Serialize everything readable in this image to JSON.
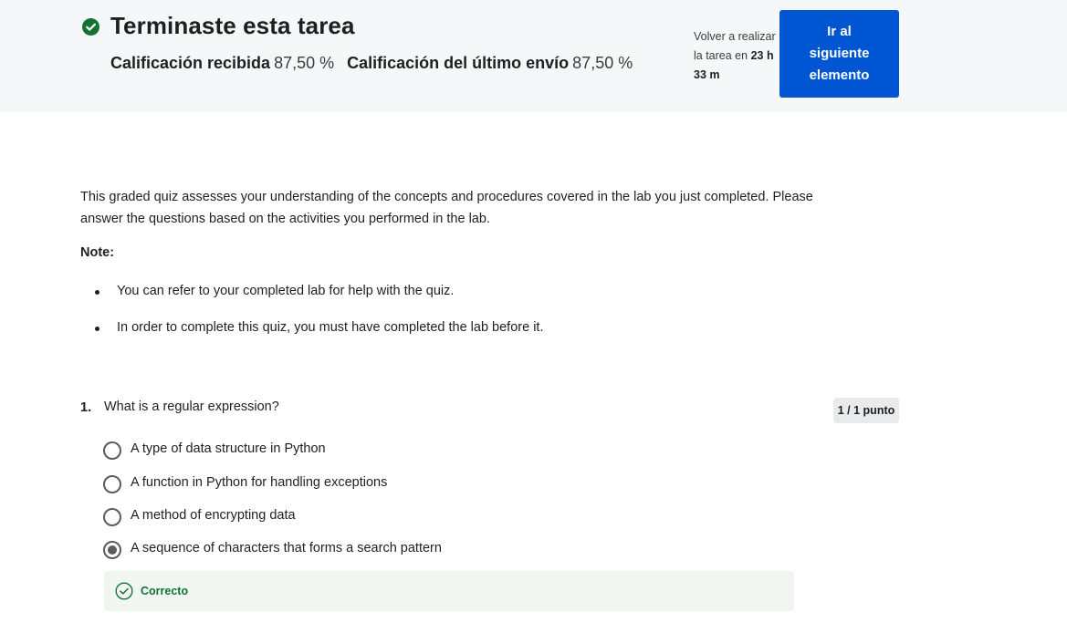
{
  "banner": {
    "title": "Terminaste esta tarea",
    "grade_received_label": "Calificación recibida",
    "grade_received_value": "87,50 %",
    "last_submission_label": "Calificación del último envío",
    "last_submission_value": "87,50 %",
    "retake_prefix": "Volver a realizar la tarea en",
    "retake_hours": "23 h",
    "retake_minutes": "33 m",
    "next_button_label": "Ir al siguiente elemento",
    "success_color": "#137333",
    "button_color": "#0056d2"
  },
  "intro": {
    "text": "This graded quiz assesses your understanding of the concepts and procedures covered in the lab you just completed. Please answer the questions based on the activities you performed in the lab.",
    "note_label": "Note:",
    "bullets": [
      "You can refer to your completed lab for help with the quiz.",
      "In order to complete this quiz, you must have completed the lab before it."
    ]
  },
  "question": {
    "number": "1.",
    "text": "What is a regular expression?",
    "points": "1 / 1 punto",
    "options": [
      {
        "label": "A type of data structure in Python",
        "selected": false
      },
      {
        "label": "A function in Python for handling exceptions",
        "selected": false
      },
      {
        "label": "A method of encrypting data",
        "selected": false
      },
      {
        "label": "A sequence of characters that forms a search pattern",
        "selected": true
      }
    ],
    "feedback": "Correcto"
  }
}
